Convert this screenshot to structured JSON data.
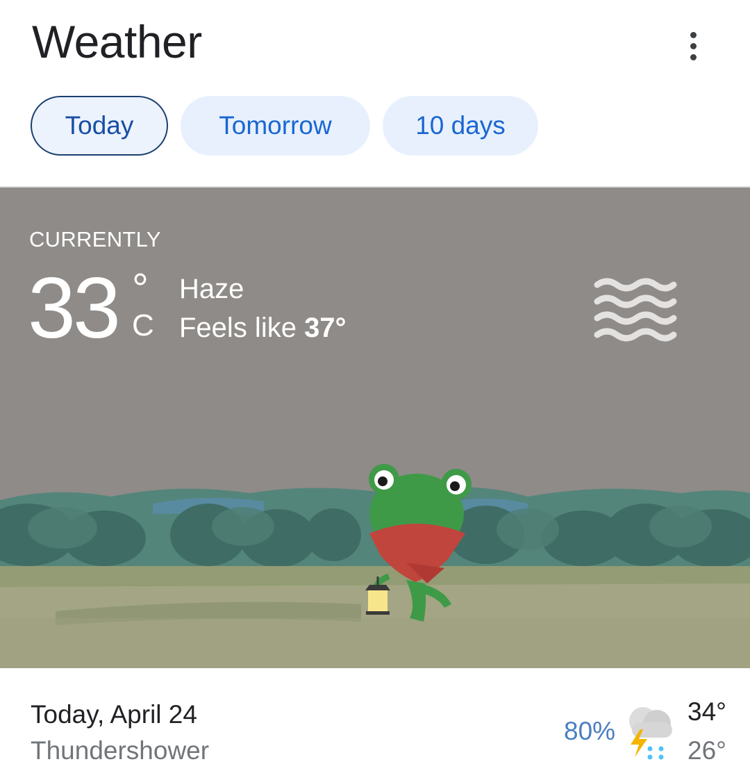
{
  "header": {
    "title": "Weather",
    "more_icon": "more-vert-icon"
  },
  "tabs": [
    {
      "label": "Today",
      "selected": true
    },
    {
      "label": "Tomorrow",
      "selected": false
    },
    {
      "label": "10 days",
      "selected": false
    }
  ],
  "current": {
    "label": "CURRENTLY",
    "temperature": "33",
    "degree_symbol": "°",
    "unit": "C",
    "condition": "Haze",
    "feels_like_prefix": "Feels like ",
    "feels_like_value": "37°",
    "condition_icon": "haze-icon",
    "illustration": "frog-with-lantern"
  },
  "summary": {
    "day": "Today, April 24",
    "condition": "Thundershower",
    "precipitation": "80%",
    "icon": "thunderstorm-icon",
    "high": "34°",
    "low": "26°"
  },
  "colors": {
    "accent": "#1967d2",
    "tab_bg": "#e8f0fe",
    "scene_bg": "#8f8b88",
    "precip": "#4a7fc1"
  }
}
